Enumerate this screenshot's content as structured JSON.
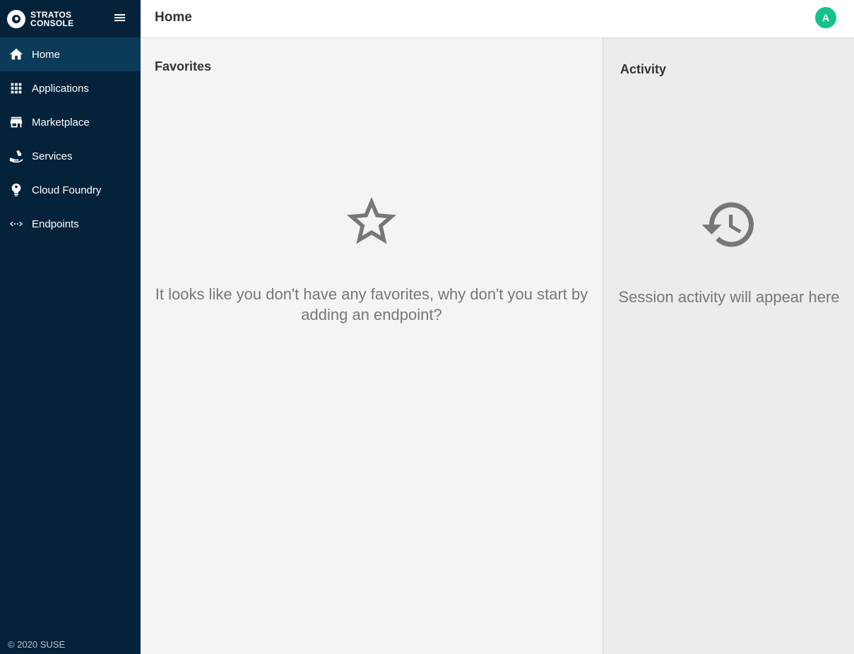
{
  "brand": {
    "line1": "STRATOS",
    "line2": "CONSOLE"
  },
  "sidebar": {
    "items": [
      {
        "label": "Home",
        "icon": "home-icon",
        "active": true
      },
      {
        "label": "Applications",
        "icon": "apps-grid-icon"
      },
      {
        "label": "Marketplace",
        "icon": "store-icon"
      },
      {
        "label": "Services",
        "icon": "services-hand-icon"
      },
      {
        "label": "Cloud Foundry",
        "icon": "cloud-foundry-icon"
      },
      {
        "label": "Endpoints",
        "icon": "endpoints-icon"
      }
    ],
    "copyright": "© 2020 SUSE"
  },
  "header": {
    "title": "Home",
    "avatar_initial": "A",
    "avatar_color": "#15c28c"
  },
  "favorites": {
    "title": "Favorites",
    "empty_icon": "star-outline-icon",
    "empty_message": "It looks like you don't have any favorites, why don't you start by adding an endpoint?"
  },
  "activity": {
    "title": "Activity",
    "empty_icon": "history-icon",
    "empty_message": "Session activity will appear here"
  },
  "colors": {
    "sidebar_bg": "#04223a",
    "sidebar_active": "#0c3a59",
    "accent": "#15c28c"
  }
}
